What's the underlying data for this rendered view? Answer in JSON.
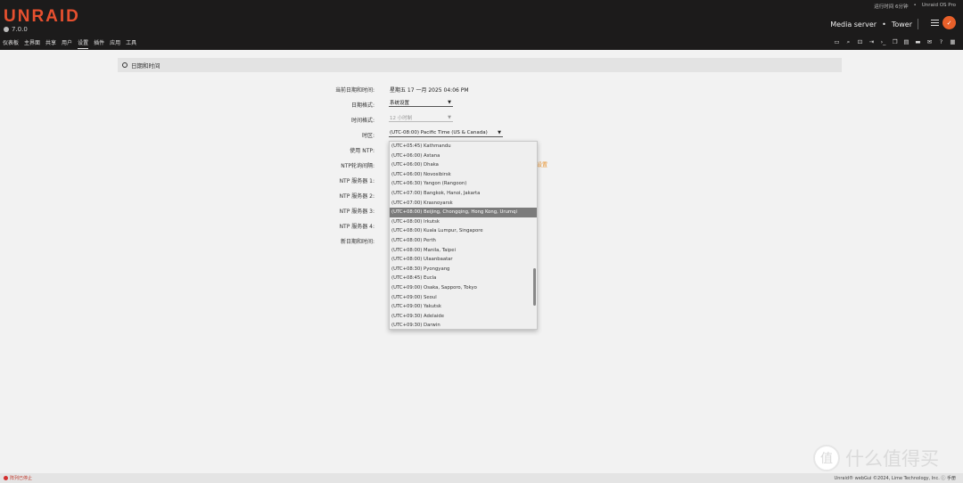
{
  "header": {
    "logo": "UNRAID",
    "version": "7.0.0",
    "uptime": "运行时间 6分钟",
    "edition": "Unraid OS Pro",
    "server_desc": "Media server",
    "server_name": "Tower"
  },
  "nav": [
    "仪表板",
    "主界面",
    "共享",
    "用户",
    "设置",
    "插件",
    "应用",
    "工具"
  ],
  "active_tab": "设置",
  "section_title": "日期和时间",
  "form": {
    "current_label": "当前日期和时间:",
    "current_value": "星期五 17 一月 2025 04:06 PM",
    "date_format_label": "日期格式:",
    "date_format_value": "系统设置",
    "time_format_label": "时间格式:",
    "time_format_value": "12 小时制",
    "timezone_label": "时区:",
    "timezone_value": "(UTC-08:00) Pacific Time (US & Canada)",
    "ntp_label": "使用 NTP:",
    "ntp_interval_label": "NTP轮询间隔:",
    "ntp1_label": "NTP 服务器 1:",
    "ntp2_label": "NTP 服务器 2:",
    "ntp3_label": "NTP 服务器 3:",
    "ntp4_label": "NTP 服务器 4:",
    "new_label": "新日期和时间:",
    "link_text": "设置"
  },
  "dropdown": {
    "options": [
      "(UTC+05:45) Kathmandu",
      "(UTC+06:00) Astana",
      "(UTC+06:00) Dhaka",
      "(UTC+06:00) Novosibirsk",
      "(UTC+06:30) Yangon (Rangoon)",
      "(UTC+07:00) Bangkok, Hanoi, Jakarta",
      "(UTC+07:00) Krasnoyarsk",
      "(UTC+08:00) Beijing, Chongqing, Hong Kong, Urumqi",
      "(UTC+08:00) Irkutsk",
      "(UTC+08:00) Kuala Lumpur, Singapore",
      "(UTC+08:00) Perth",
      "(UTC+08:00) Manila, Taipei",
      "(UTC+08:00) Ulaanbaatar",
      "(UTC+08:30) Pyongyang",
      "(UTC+08:45) Eucla",
      "(UTC+09:00) Osaka, Sapporo, Tokyo",
      "(UTC+09:00) Seoul",
      "(UTC+09:00) Yakutsk",
      "(UTC+09:30) Adelaide",
      "(UTC+09:30) Darwin"
    ],
    "selected_index": 7
  },
  "footer": {
    "array_status": "阵列已停止",
    "copyright": "Unraid® webGui ©2024, Lime Technology, Inc.",
    "manual": "手册"
  },
  "watermark": "什么值得买",
  "colors": {
    "accent": "#e7502f",
    "header_bg": "#1c1b1b"
  }
}
